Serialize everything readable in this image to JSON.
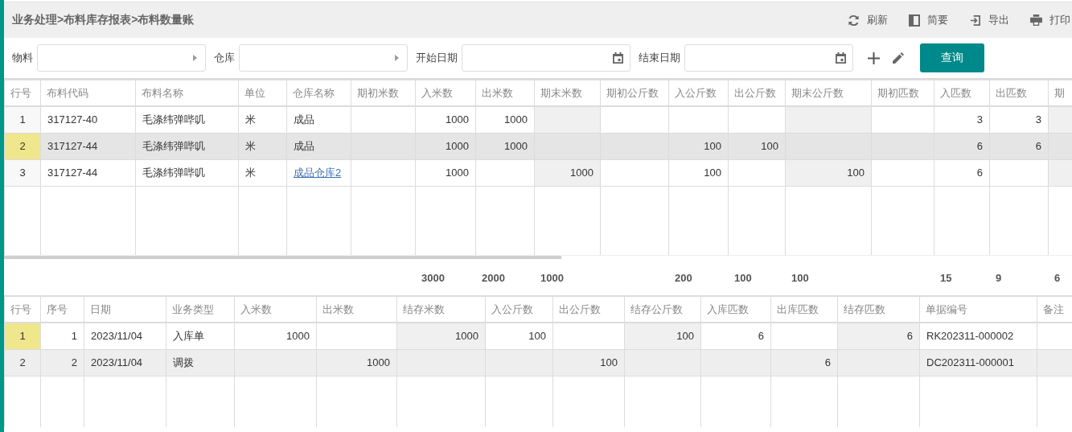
{
  "breadcrumb": "业务处理>布料库存报表>布料数量账",
  "toolbar": [
    {
      "label": "刷新"
    },
    {
      "label": "简要"
    },
    {
      "label": "导出"
    },
    {
      "label": "打印"
    }
  ],
  "filters": [
    {
      "label": "物料",
      "kind": "select"
    },
    {
      "label": "仓库",
      "kind": "select"
    },
    {
      "label": "开始日期",
      "kind": "date"
    },
    {
      "label": "结束日期",
      "kind": "date"
    }
  ],
  "query_button": "查询",
  "summary_table": {
    "columns": [
      {
        "label": "行号",
        "kind": "index"
      },
      {
        "label": "布料代码",
        "kind": "text"
      },
      {
        "label": "布料名称",
        "kind": "text"
      },
      {
        "label": "单位",
        "kind": "text"
      },
      {
        "label": "仓库名称",
        "kind": "text"
      },
      {
        "label": "期初米数",
        "kind": "number"
      },
      {
        "label": "入米数",
        "kind": "number"
      },
      {
        "label": "出米数",
        "kind": "number"
      },
      {
        "label": "期末米数",
        "kind": "number",
        "shaded": true
      },
      {
        "label": "期初公斤数",
        "kind": "number"
      },
      {
        "label": "入公斤数",
        "kind": "number"
      },
      {
        "label": "出公斤数",
        "kind": "number"
      },
      {
        "label": "期末公斤数",
        "kind": "number",
        "shaded": true
      },
      {
        "label": "期初匹数",
        "kind": "number"
      },
      {
        "label": "入匹数",
        "kind": "number"
      },
      {
        "label": "出匹数",
        "kind": "number"
      },
      {
        "label": "期",
        "kind": "number",
        "shaded": true
      }
    ],
    "rows": [
      {
        "selected": false,
        "highlighted": false,
        "cells": [
          "1",
          "317127-40",
          "毛涤纬弹哔叽",
          "米",
          "成品",
          null,
          "1000",
          "1000",
          null,
          null,
          null,
          null,
          null,
          null,
          "3",
          "3",
          null
        ]
      },
      {
        "selected": true,
        "highlighted": true,
        "cells": [
          "2",
          "317127-44",
          "毛涤纬弹哔叽",
          "米",
          "成品",
          null,
          "1000",
          "1000",
          null,
          null,
          "100",
          "100",
          null,
          null,
          "6",
          "6",
          null
        ]
      },
      {
        "selected": false,
        "highlighted": false,
        "cells": [
          "3",
          "317127-44",
          "毛涤纬弹哔叽",
          "米",
          {
            "text": "成品仓库2",
            "kind": "link"
          },
          null,
          "1000",
          null,
          "1000",
          null,
          "100",
          null,
          "100",
          null,
          "6",
          null,
          null
        ]
      }
    ]
  },
  "summary_totals": [
    "3000",
    "2000",
    "1000",
    "200",
    "100",
    "100",
    "15",
    "9",
    "6"
  ],
  "detail_table": {
    "columns": [
      {
        "label": "行号",
        "kind": "index"
      },
      {
        "label": "序号",
        "kind": "number"
      },
      {
        "label": "日期",
        "kind": "text"
      },
      {
        "label": "业务类型",
        "kind": "text"
      },
      {
        "label": "入米数",
        "kind": "number"
      },
      {
        "label": "出米数",
        "kind": "number"
      },
      {
        "label": "结存米数",
        "kind": "number",
        "shaded": true
      },
      {
        "label": "入公斤数",
        "kind": "number"
      },
      {
        "label": "出公斤数",
        "kind": "number"
      },
      {
        "label": "结存公斤数",
        "kind": "number",
        "shaded": true
      },
      {
        "label": "入库匹数",
        "kind": "number"
      },
      {
        "label": "出库匹数",
        "kind": "number"
      },
      {
        "label": "结存匹数",
        "kind": "number",
        "shaded": true
      },
      {
        "label": "单据编号",
        "kind": "text"
      },
      {
        "label": "备注",
        "kind": "text"
      }
    ],
    "rows": [
      {
        "selected": true,
        "highlighted": false,
        "cells": [
          "1",
          "1",
          "2023/11/04",
          "入库单",
          "1000",
          null,
          "1000",
          "100",
          null,
          "100",
          "6",
          null,
          "6",
          "RK202311-000002",
          null
        ]
      },
      {
        "selected": false,
        "highlighted": true,
        "cells": [
          "2",
          "2",
          "2023/11/04",
          "调拨",
          null,
          "1000",
          null,
          null,
          "100",
          null,
          null,
          "6",
          null,
          "DC202311-000001",
          null
        ]
      }
    ]
  }
}
